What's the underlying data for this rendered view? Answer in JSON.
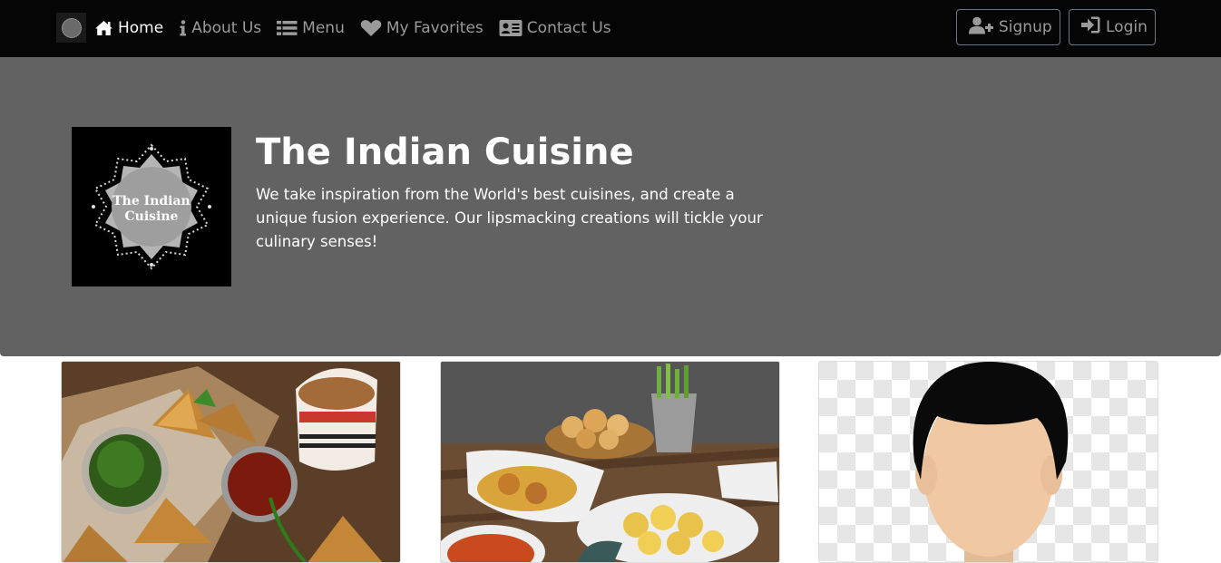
{
  "navbar": {
    "brand_icon": "restaurant-logo",
    "links": [
      {
        "label": "Home",
        "icon": "home-icon",
        "active": true
      },
      {
        "label": "About Us",
        "icon": "info-icon",
        "active": false
      },
      {
        "label": "Menu",
        "icon": "list-icon",
        "active": false
      },
      {
        "label": "My Favorites",
        "icon": "heart-icon",
        "active": false
      },
      {
        "label": "Contact Us",
        "icon": "address-card-icon",
        "active": false
      }
    ],
    "signup_label": "Signup",
    "login_label": "Login"
  },
  "hero": {
    "title": "The Indian Cuisine",
    "description": "We take inspiration from the World's best cuisines, and create a unique fusion experience. Our lipsmacking creations will tickle your culinary senses!",
    "logo_text": [
      "The Indian",
      "Cuisine"
    ]
  },
  "cards": [
    {
      "image": "samosa-and-chai-photo"
    },
    {
      "image": "pani-puri-chaat-photo"
    },
    {
      "image": "avatar-placeholder"
    }
  ],
  "colors": {
    "navbar_bg": "#050505",
    "jumbotron_bg": "#626262",
    "nav_text": "#9a9a9a",
    "active_text": "#ffffff"
  }
}
